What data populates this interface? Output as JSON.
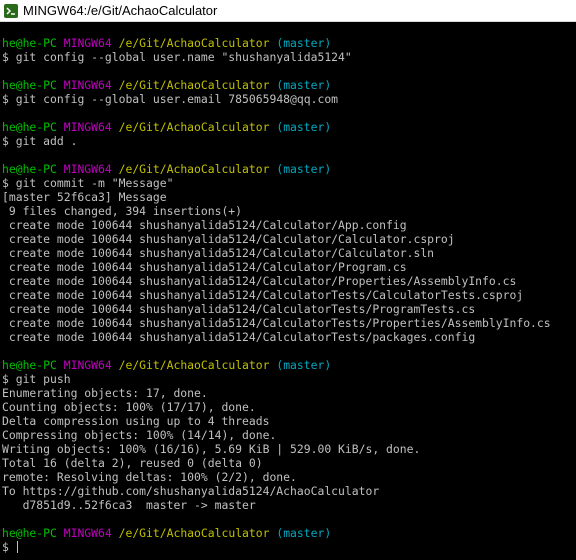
{
  "window": {
    "title": "MINGW64:/e/Git/AchaoCalculator"
  },
  "prompt": {
    "user_host": "he@he-PC",
    "shell": "MINGW64",
    "path": "/e/Git/AchaoCalculator",
    "branch": "(master)",
    "symbol": "$"
  },
  "terminal": {
    "cmd1": "git config --global user.name \"shushanyalida5124\"",
    "cmd2": "git config --global user.email 785065948@qq.com",
    "cmd3": "git add .",
    "cmd4": "git commit -m \"Message\"",
    "commit_output": [
      "[master 52f6ca3] Message",
      " 9 files changed, 394 insertions(+)",
      " create mode 100644 shushanyalida5124/Calculator/App.config",
      " create mode 100644 shushanyalida5124/Calculator/Calculator.csproj",
      " create mode 100644 shushanyalida5124/Calculator/Calculator.sln",
      " create mode 100644 shushanyalida5124/Calculator/Program.cs",
      " create mode 100644 shushanyalida5124/Calculator/Properties/AssemblyInfo.cs",
      " create mode 100644 shushanyalida5124/CalculatorTests/CalculatorTests.csproj",
      " create mode 100644 shushanyalida5124/CalculatorTests/ProgramTests.cs",
      " create mode 100644 shushanyalida5124/CalculatorTests/Properties/AssemblyInfo.cs",
      " create mode 100644 shushanyalida5124/CalculatorTests/packages.config"
    ],
    "cmd5": "git push",
    "push_output": [
      "Enumerating objects: 17, done.",
      "Counting objects: 100% (17/17), done.",
      "Delta compression using up to 4 threads",
      "Compressing objects: 100% (14/14), done.",
      "Writing objects: 100% (16/16), 5.69 KiB | 529.00 KiB/s, done.",
      "Total 16 (delta 2), reused 0 (delta 0)",
      "remote: Resolving deltas: 100% (2/2), done.",
      "To https://github.com/shushanyalida5124/AchaoCalculator",
      "   d7851d9..52f6ca3  master -> master"
    ]
  },
  "colors": {
    "background": "#000000",
    "text": "#c0c0c0",
    "user_host": "#00c000",
    "shell": "#c000c0",
    "path": "#c0c000",
    "branch": "#00a8c0"
  }
}
